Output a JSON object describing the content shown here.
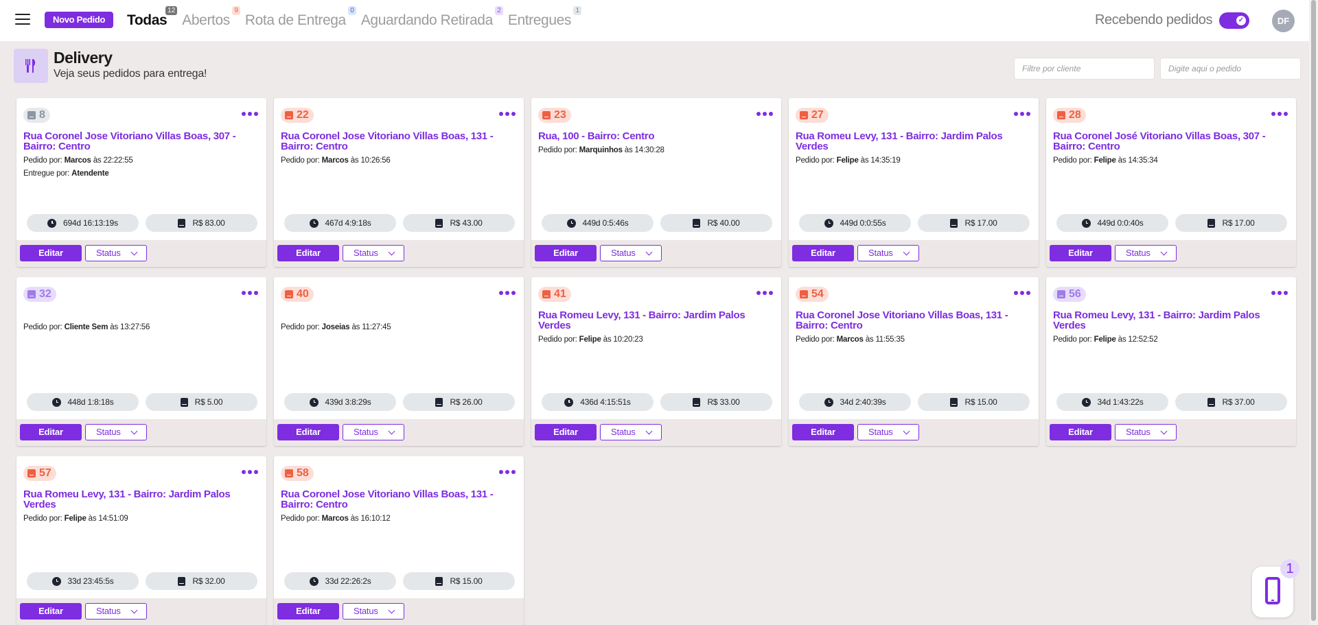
{
  "header": {
    "new_order_label": "Novo Pedido",
    "tabs": [
      {
        "label": "Todas",
        "count": "12",
        "active": true,
        "count_bg": "#757575",
        "count_color": "#ffffff"
      },
      {
        "label": "Abertos",
        "count": "9",
        "active": false,
        "count_bg": "#fcded7",
        "count_color": "#ee6042"
      },
      {
        "label": "Rota de Entrega",
        "count": "0",
        "active": false,
        "count_bg": "#dbe5fb",
        "count_color": "#3f67c9"
      },
      {
        "label": "Aguardando Retirada",
        "count": "2",
        "active": false,
        "count_bg": "#e7dcfa",
        "count_color": "#8a5cdc"
      },
      {
        "label": "Entregues",
        "count": "1",
        "active": false,
        "count_bg": "#e4e7ea",
        "count_color": "#7b8794"
      }
    ],
    "receiving_label": "Recebendo pedidos",
    "receiving_enabled": true,
    "user_initials": "DF"
  },
  "page": {
    "title": "Delivery",
    "subtitle": "Veja seus pedidos para entrega!",
    "filter_client_placeholder": "Filtre por cliente",
    "filter_order_placeholder": "Digite aqui o pedido"
  },
  "labels": {
    "ordered_by": "Pedido por:",
    "at": "às",
    "delivered_by": "Entregue por:",
    "edit": "Editar",
    "status": "Status"
  },
  "orders": [
    {
      "number": "8",
      "badge": "gray",
      "address": "Rua Coronel Jose Vitoriano Villas Boas, 307 - Bairro: Centro",
      "ordered_by": "Marcos",
      "time": "22:22:55",
      "delivered_by": "Atendente",
      "elapsed": "694d 16:13:19s",
      "price": "R$ 83.00"
    },
    {
      "number": "22",
      "badge": "red",
      "address": "Rua Coronel Jose Vitoriano Villas Boas, 131 - Bairro: Centro",
      "ordered_by": "Marcos",
      "time": "10:26:56",
      "delivered_by": "",
      "elapsed": "467d 4:9:18s",
      "price": "R$ 43.00"
    },
    {
      "number": "23",
      "badge": "red",
      "address": "Rua, 100 - Bairro: Centro",
      "ordered_by": "Marquinhos",
      "time": "14:30:28",
      "delivered_by": "",
      "elapsed": "449d 0:5:46s",
      "price": "R$ 40.00"
    },
    {
      "number": "27",
      "badge": "red",
      "address": "Rua Romeu Levy, 131 - Bairro: Jardim Palos Verdes",
      "ordered_by": "Felipe",
      "time": "14:35:19",
      "delivered_by": "",
      "elapsed": "449d 0:0:55s",
      "price": "R$ 17.00"
    },
    {
      "number": "28",
      "badge": "red",
      "address": "Rua Coronel José Vitoriano Villas Boas, 307 - Bairro: Centro",
      "ordered_by": "Felipe",
      "time": "14:35:34",
      "delivered_by": "",
      "elapsed": "449d 0:0:40s",
      "price": "R$ 17.00"
    },
    {
      "number": "32",
      "badge": "purple",
      "address": "",
      "ordered_by": "Cliente Sem",
      "time": "13:27:56",
      "delivered_by": "",
      "elapsed": "448d 1:8:18s",
      "price": "R$ 5.00"
    },
    {
      "number": "40",
      "badge": "red",
      "address": "",
      "ordered_by": "Joseias",
      "time": "11:27:45",
      "delivered_by": "",
      "elapsed": "439d 3:8:29s",
      "price": "R$ 26.00"
    },
    {
      "number": "41",
      "badge": "red",
      "address": "Rua Romeu Levy, 131 - Bairro: Jardim Palos Verdes",
      "ordered_by": "Felipe",
      "time": "10:20:23",
      "delivered_by": "",
      "elapsed": "436d 4:15:51s",
      "price": "R$ 33.00"
    },
    {
      "number": "54",
      "badge": "red",
      "address": "Rua Coronel Jose Vitoriano Villas Boas, 131 - Bairro: Centro",
      "ordered_by": "Marcos",
      "time": "11:55:35",
      "delivered_by": "",
      "elapsed": "34d 2:40:39s",
      "price": "R$ 15.00"
    },
    {
      "number": "56",
      "badge": "purple",
      "address": "Rua Romeu Levy, 131 - Bairro: Jardim Palos Verdes",
      "ordered_by": "Felipe",
      "time": "12:52:52",
      "delivered_by": "",
      "elapsed": "34d 1:43:22s",
      "price": "R$ 37.00"
    },
    {
      "number": "57",
      "badge": "red",
      "address": "Rua Romeu Levy, 131 - Bairro: Jardim Palos Verdes",
      "ordered_by": "Felipe",
      "time": "14:51:09",
      "delivered_by": "",
      "elapsed": "33d 23:45:5s",
      "price": "R$ 32.00"
    },
    {
      "number": "58",
      "badge": "red",
      "address": "Rua Coronel Jose Vitoriano Villas Boas, 131 - Bairro: Centro",
      "ordered_by": "Marcos",
      "time": "16:10:12",
      "delivered_by": "",
      "elapsed": "33d 22:26:2s",
      "price": "R$ 15.00"
    }
  ],
  "phone_widget": {
    "count": "1"
  },
  "colors": {
    "accent": "#7e2de0",
    "background": "#efeaea"
  }
}
